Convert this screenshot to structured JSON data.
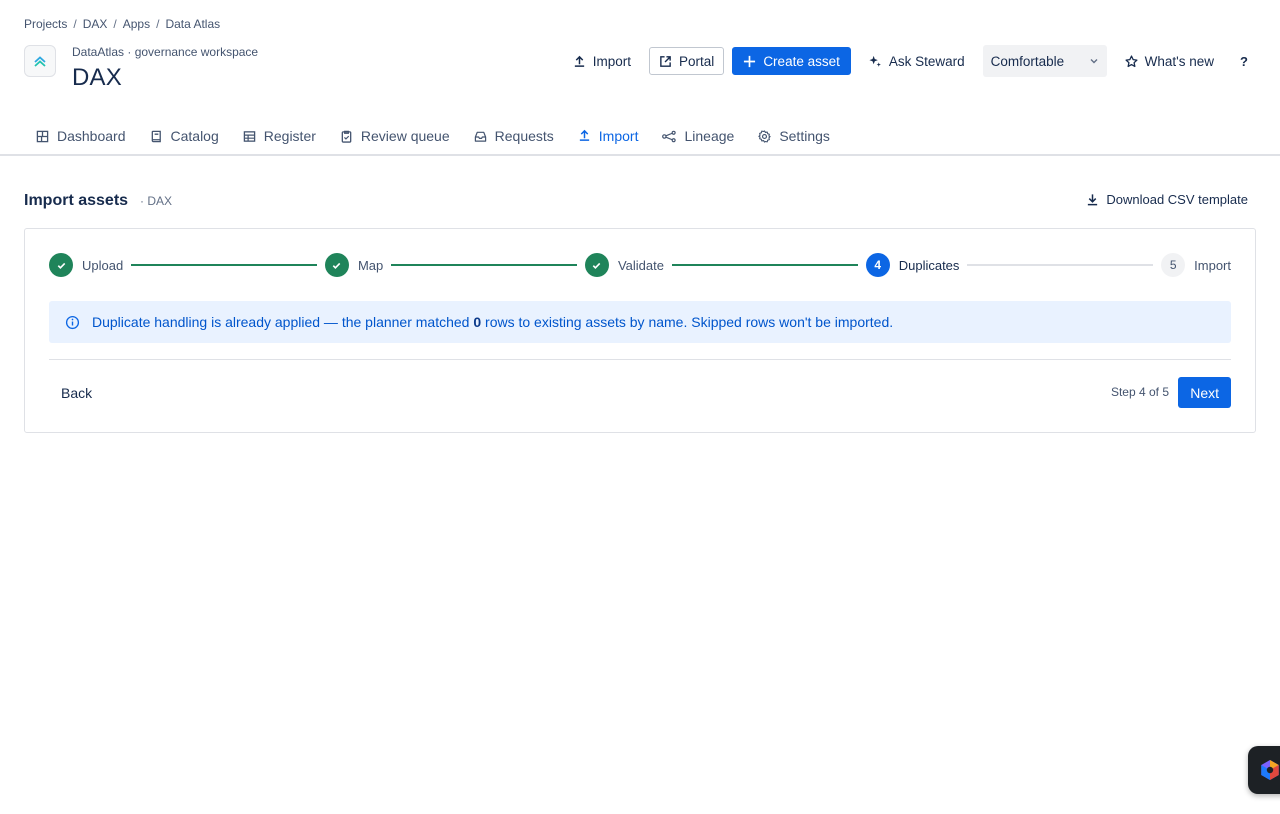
{
  "breadcrumb": [
    "Projects",
    "DAX",
    "Apps",
    "Data Atlas"
  ],
  "app": {
    "subtitle": "DataAtlas · governance workspace",
    "title": "DAX"
  },
  "header_actions": {
    "import": "Import",
    "portal": "Portal",
    "create_asset": "Create asset",
    "ask_steward": "Ask Steward",
    "density": "Comfortable",
    "whats_new": "What's new",
    "help": "?"
  },
  "tabs": [
    {
      "label": "Dashboard",
      "icon": "dashboard-icon"
    },
    {
      "label": "Catalog",
      "icon": "book-icon"
    },
    {
      "label": "Register",
      "icon": "table-icon"
    },
    {
      "label": "Review queue",
      "icon": "clipboard-check-icon"
    },
    {
      "label": "Requests",
      "icon": "inbox-icon"
    },
    {
      "label": "Import",
      "icon": "upload-icon",
      "active": true
    },
    {
      "label": "Lineage",
      "icon": "lineage-icon"
    },
    {
      "label": "Settings",
      "icon": "gear-icon"
    }
  ],
  "section": {
    "title": "Import assets",
    "context": "· DAX",
    "download": "Download CSV template"
  },
  "steps": [
    {
      "label": "Upload",
      "state": "done"
    },
    {
      "label": "Map",
      "state": "done"
    },
    {
      "label": "Validate",
      "state": "done"
    },
    {
      "label": "Duplicates",
      "state": "current",
      "number": "4"
    },
    {
      "label": "Import",
      "state": "todo",
      "number": "5"
    }
  ],
  "banner": {
    "before": "Duplicate handling is already applied — the planner matched ",
    "count": "0",
    "after": " rows to existing assets by name. Skipped rows won't be imported."
  },
  "footer": {
    "back": "Back",
    "step_info": "Step 4 of 5",
    "next": "Next"
  },
  "colors": {
    "primary": "#0c66e4",
    "success": "#1f845a",
    "info_bg": "#e9f2ff"
  }
}
